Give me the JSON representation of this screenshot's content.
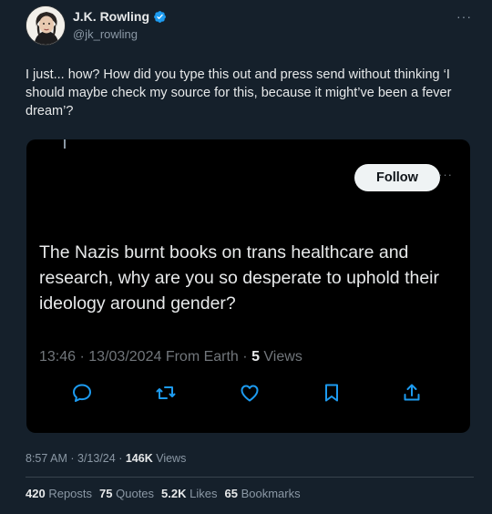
{
  "author": {
    "name": "J.K. Rowling",
    "handle": "@jk_rowling"
  },
  "tweet": {
    "text": "I just... how? How did you type this out and press send without thinking ‘I should maybe check my source for this, because it might’ve been a fever dream’?"
  },
  "quoted_card": {
    "follow_label": "Follow",
    "text": "The Nazis burnt books on trans healthcare and research, why are you so desperate to uphold their ideology around gender?",
    "time": "13:46",
    "date": "13/03/2024",
    "source": "From Earth",
    "views_count": "5",
    "views_label": "Views"
  },
  "meta": {
    "time": "8:57 AM",
    "date": "3/13/24",
    "views_count": "146K",
    "views_label": "Views"
  },
  "stats": {
    "reposts_count": "420",
    "reposts_label": "Reposts",
    "quotes_count": "75",
    "quotes_label": "Quotes",
    "likes_count": "5.2K",
    "likes_label": "Likes",
    "bookmarks_count": "65",
    "bookmarks_label": "Bookmarks"
  },
  "colors": {
    "background": "#15202b",
    "card_background": "#000000",
    "accent_blue": "#1d9bf0",
    "secondary_text": "#8b98a5"
  },
  "icons": [
    "verified-badge-icon",
    "more-icon",
    "reply-icon",
    "repost-icon",
    "like-icon",
    "bookmark-icon",
    "share-icon"
  ]
}
